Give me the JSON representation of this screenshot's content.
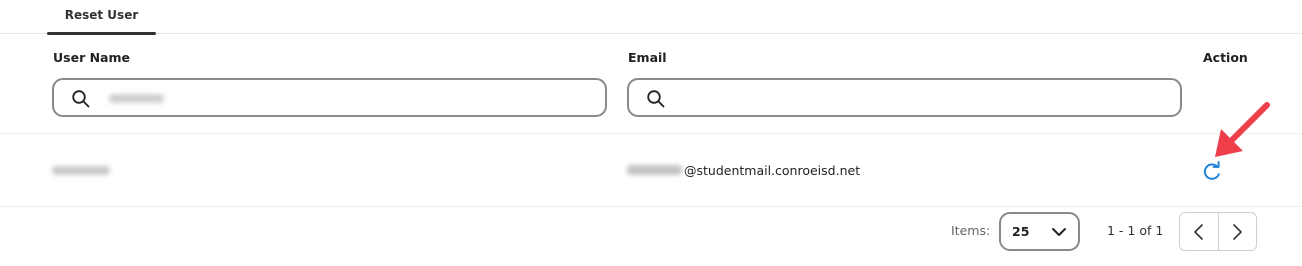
{
  "tabs": [
    {
      "label": "Reset User",
      "active": true
    }
  ],
  "table": {
    "columns": {
      "user_name": "User Name",
      "email": "Email",
      "action": "Action"
    },
    "filters": {
      "user_name_value": "",
      "email_value": ""
    },
    "rows": [
      {
        "user_name": "",
        "email_domain": "@studentmail.conroeisd.net",
        "action_icon": "refresh-icon"
      }
    ]
  },
  "pagination": {
    "items_label": "Items:",
    "page_size": "25",
    "range_text": "1 - 1 of 1"
  },
  "colors": {
    "accent": "#1a7fd6",
    "annotation": "#ef3f4a",
    "border": "#8a8a8a"
  }
}
